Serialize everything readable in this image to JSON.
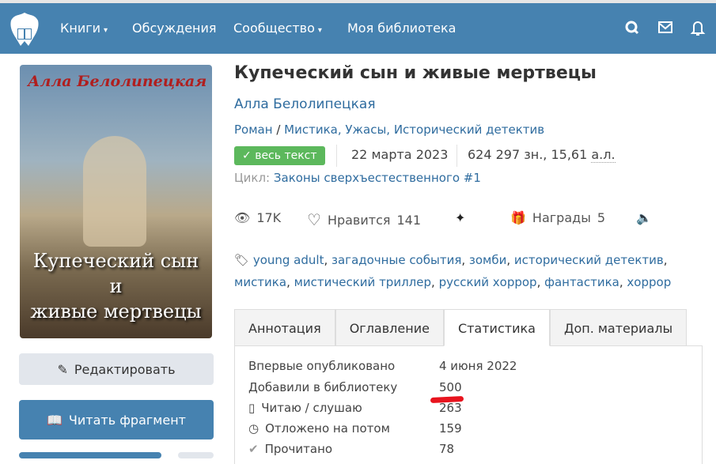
{
  "nav": {
    "items": [
      {
        "label": "Книги",
        "caret": "▾"
      },
      {
        "label": "Обсуждения"
      },
      {
        "label": "Сообщество",
        "caret": "▾"
      },
      {
        "label": "Моя библиотека"
      }
    ]
  },
  "cover": {
    "author": "Алла Белолипецкая",
    "title_lines": [
      "Купеческий сын",
      "и",
      "живые мертвецы"
    ]
  },
  "sidebar": {
    "edit_label": "Редактировать",
    "read_label": "Читать фрагмент"
  },
  "book": {
    "title": "Купеческий сын и живые мертвецы",
    "author": "Алла Белолипецкая",
    "form": "Роман",
    "genres": "Мистика, Ужасы, Исторический детектив",
    "status_badge": "весь текст",
    "date": "22 марта 2023",
    "size": "624 297 зн., 15,61",
    "size_unit": "а.л.",
    "cycle_label": "Цикл:",
    "cycle": "Законы сверхъестественного #1"
  },
  "stats": {
    "views": "17K",
    "likes_label": "Нравится",
    "likes": "141",
    "awards_label": "Награды",
    "awards": "5"
  },
  "tags": [
    "young adult",
    "загадочные события",
    "зомби",
    "исторический детектив",
    "мистика",
    "мистический триллер",
    "русский хоррор",
    "фантастика",
    "хоррор"
  ],
  "tabs": [
    "Аннотация",
    "Оглавление",
    "Статистика",
    "Доп. материалы"
  ],
  "statistics": [
    {
      "label": "Впервые опубликовано",
      "value": "4 июня 2022"
    },
    {
      "label": "Добавили в библиотеку",
      "value": "500"
    },
    {
      "label": "Читаю / слушаю",
      "value": "263"
    },
    {
      "label": "Отложено на потом",
      "value": "159"
    },
    {
      "label": "Прочитано",
      "value": "78"
    }
  ],
  "colors": {
    "header": "#4682b0",
    "badge": "#5cb85c",
    "link": "#2f6c9f"
  }
}
